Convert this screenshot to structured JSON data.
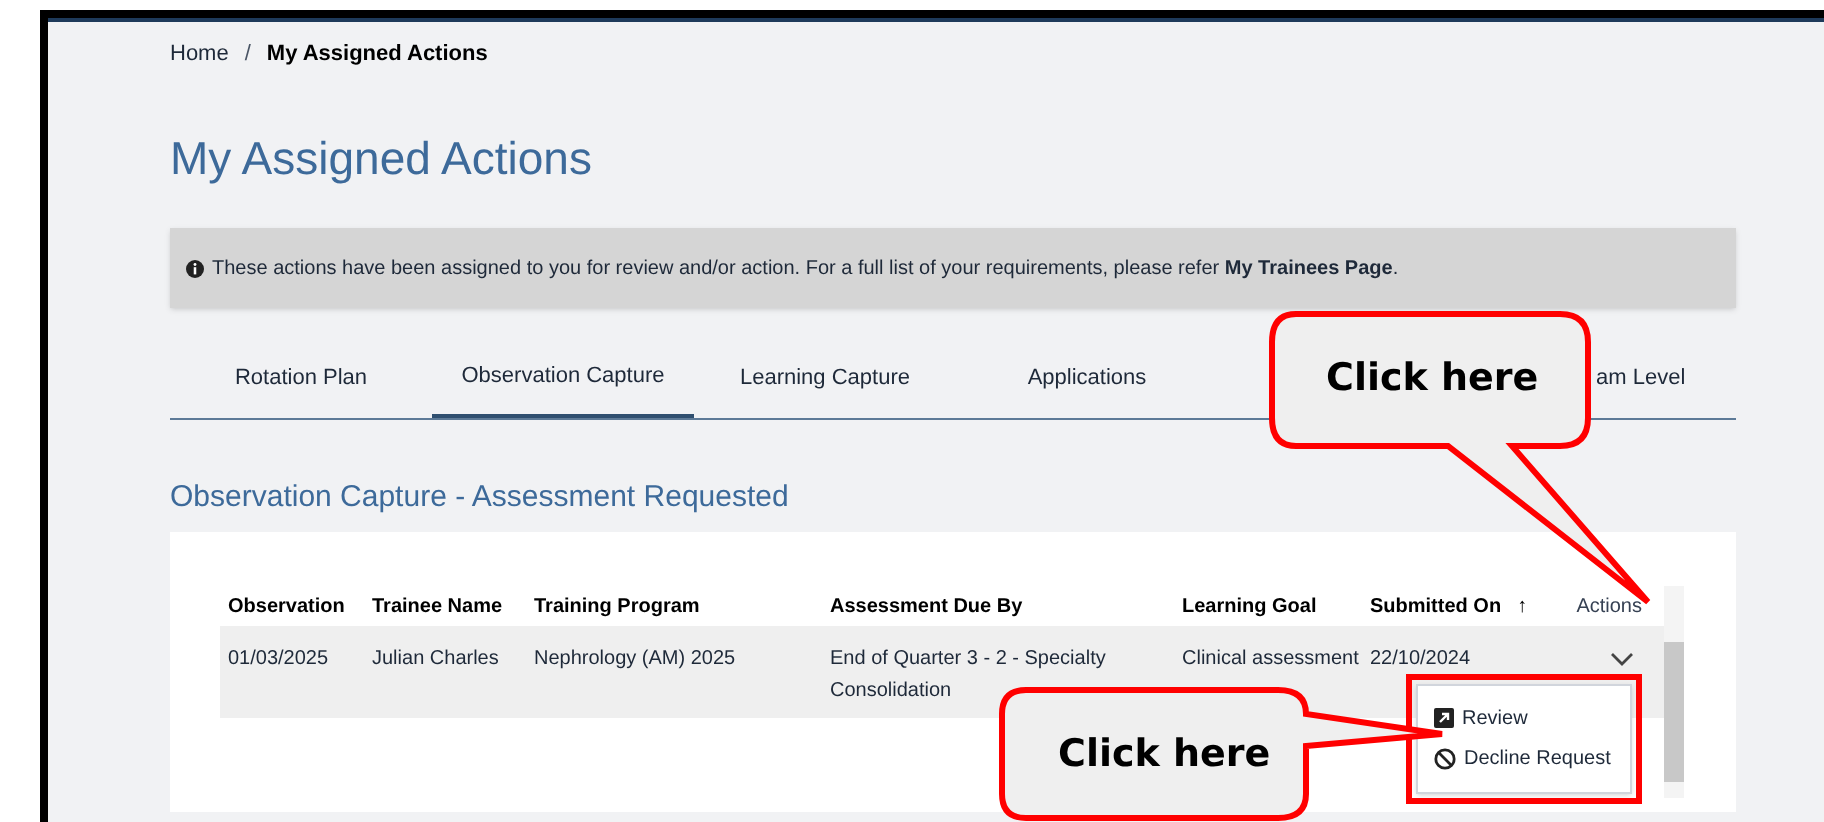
{
  "breadcrumb": [
    {
      "label": "Home",
      "current": false
    },
    {
      "label": "My Assigned Actions",
      "current": true
    }
  ],
  "breadcrumb_separator": "/",
  "page_title": "My Assigned Actions",
  "info_banner": "These actions have been assigned to you for review and/or action. For a full list of your requirements, please refer **My Trainees Page**.",
  "tabs": [
    {
      "label": "Rotation Plan",
      "selected": false
    },
    {
      "label": "Observation Capture",
      "selected": true
    },
    {
      "label": "Learning Capture",
      "selected": false
    },
    {
      "label": "Applications",
      "selected": false
    },
    {
      "label": "am Level",
      "selected": false
    }
  ],
  "section_title": "Observation Capture - Assessment Requested",
  "table": {
    "columns": [
      {
        "label": "Observation",
        "kind": "bold"
      },
      {
        "label": "Trainee Name",
        "kind": "bold"
      },
      {
        "label": "Training Program",
        "kind": "bold"
      },
      {
        "label": "Assessment Due By",
        "kind": "bold"
      },
      {
        "label": "Learning Goal",
        "kind": "bold"
      },
      {
        "label": "Submitted On",
        "kind": "sorted",
        "sort_mark": "↑"
      },
      {
        "label": "Actions",
        "kind": "plain"
      }
    ],
    "rows": [
      {
        "cells": [
          "01/03/2025",
          "Julian Charles",
          "Nephrology (AM) 2025",
          "End of Quarter 3 - 2 - Specialty Consolidation",
          "Clinical assessment",
          "22/10/2024"
        ],
        "expanded": true
      }
    ]
  },
  "action_menu": [
    {
      "label": "Review",
      "kind": "review"
    },
    {
      "label": "Decline Request",
      "kind": "decline"
    }
  ],
  "callouts": [
    {
      "text": "Click here"
    },
    {
      "text": "Click here"
    }
  ]
}
